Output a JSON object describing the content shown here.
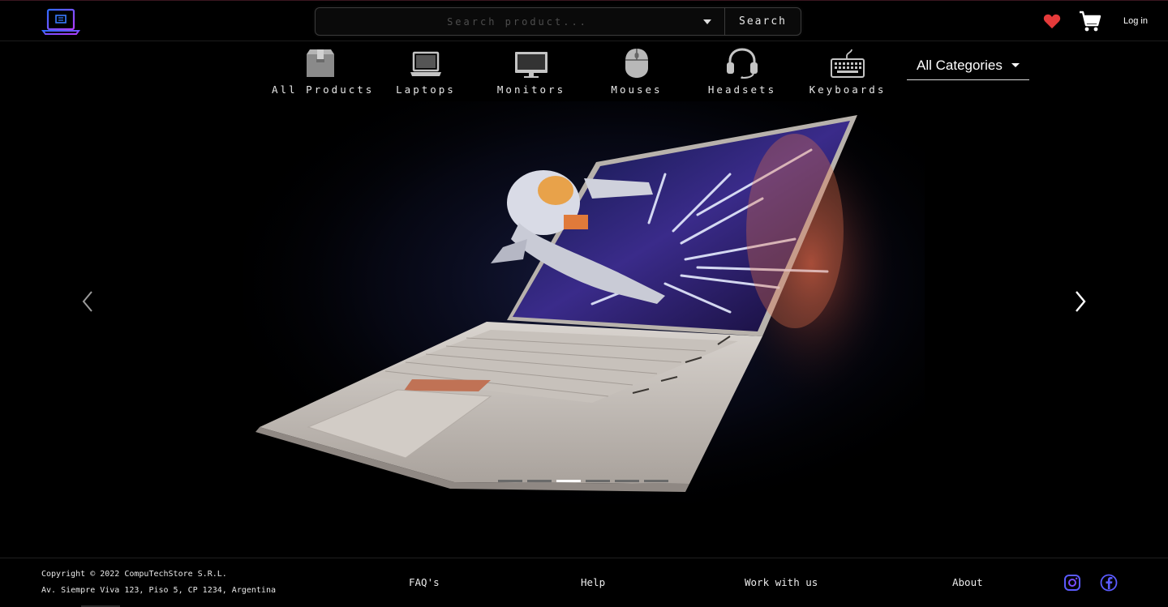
{
  "header": {
    "search": {
      "placeholder": "Search product...",
      "button_label": "Search"
    },
    "login_label": "Log in",
    "icons": {
      "logo": "laptop-logo-icon",
      "wishlist": "heart-icon",
      "cart": "cart-icon"
    }
  },
  "categories": [
    {
      "label": "All Products",
      "icon": "box-icon"
    },
    {
      "label": "Laptops",
      "icon": "laptop-icon"
    },
    {
      "label": "Monitors",
      "icon": "monitor-icon"
    },
    {
      "label": "Mouses",
      "icon": "mouse-icon"
    },
    {
      "label": "Headsets",
      "icon": "headset-icon"
    },
    {
      "label": "Keyboards",
      "icon": "keyboard-icon"
    }
  ],
  "category_select": {
    "value": "All Categories"
  },
  "carousel": {
    "slide_count": 6,
    "active_index": 2
  },
  "footer": {
    "copyright": "Copyright © 2022 CompuTechStore S.R.L.",
    "address": "Av. Siempre Viva 123, Piso 5, CP 1234, Argentina",
    "links": [
      "FAQ's",
      "Help",
      "Work with us",
      "About"
    ],
    "social": [
      "instagram-icon",
      "facebook-icon"
    ]
  },
  "colors": {
    "background": "#000000",
    "heart": "#e53a3a",
    "logo_gradient": [
      "#2f6bff",
      "#b23cff"
    ],
    "social": "#5b5bff"
  }
}
